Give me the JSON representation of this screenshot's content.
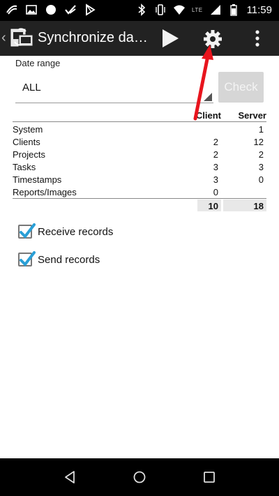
{
  "status_bar": {
    "time": "11:59",
    "network": "LTE"
  },
  "action_bar": {
    "back_glyph": "‹",
    "title": "Synchronize da…"
  },
  "date_range": {
    "label": "Date range",
    "value": "ALL"
  },
  "check_button": {
    "label": "Check"
  },
  "table": {
    "headers": {
      "client": "Client",
      "server": "Server"
    },
    "rows": [
      {
        "name": "System",
        "client": "",
        "server": "1"
      },
      {
        "name": "Clients",
        "client": "2",
        "server": "12"
      },
      {
        "name": "Projects",
        "client": "2",
        "server": "2"
      },
      {
        "name": "Tasks",
        "client": "3",
        "server": "3"
      },
      {
        "name": "Timestamps",
        "client": "3",
        "server": "0"
      },
      {
        "name": "Reports/Images",
        "client": "0",
        "server": ""
      }
    ],
    "totals": {
      "client": "10",
      "server": "18"
    }
  },
  "options": {
    "receive": {
      "label": "Receive records",
      "checked": true
    },
    "send": {
      "label": "Send records",
      "checked": true
    }
  },
  "colors": {
    "action_bar": "#222222",
    "checkbox_accent": "#2a9fd6",
    "annotation": "#e8141d"
  }
}
